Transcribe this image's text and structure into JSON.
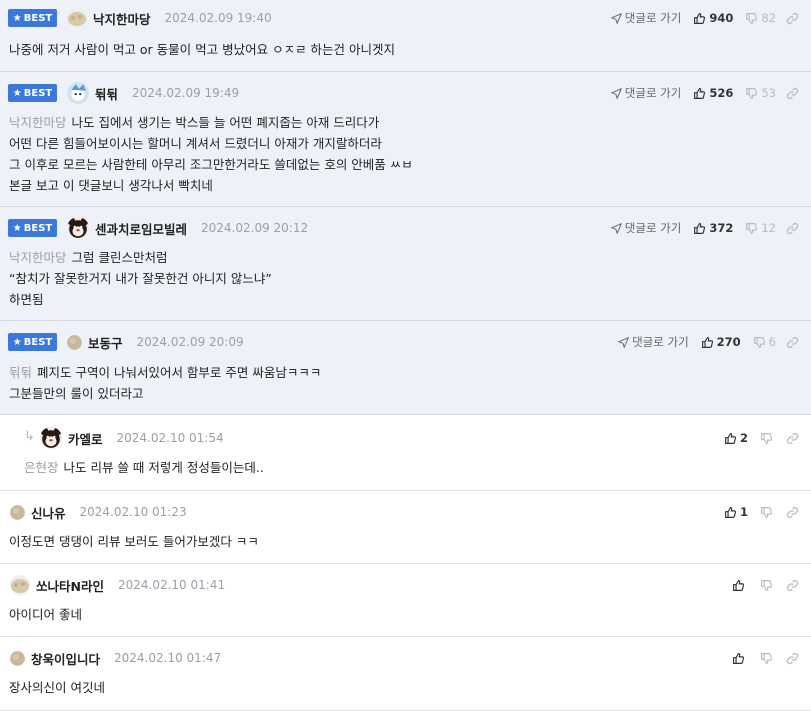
{
  "labels": {
    "best": "BEST",
    "reply_link": "댓글로 가기"
  },
  "colors": {
    "best_badge": "#3a78dc",
    "best_bg": "#eef2f8",
    "muted": "#9aa0a8"
  },
  "comments": [
    {
      "best": true,
      "nick": "낙지한마당",
      "date": "2024.02.09 19:40",
      "mention": "",
      "lines": [
        "나중에 저거 사람이 먹고 or 동물이 먹고 병났어요 ㅇㅈㄹ 하는건 아니겟지"
      ],
      "likes": "940",
      "dislikes": "82",
      "avatar_icon": "mushroom-avatar-icon"
    },
    {
      "best": true,
      "nick": "뒦뒦",
      "date": "2024.02.09 19:49",
      "mention": "낙지한마당",
      "lines": [
        "나도 집에서 생기는 박스들 늘 어떤 폐지줍는 아재 드리다가",
        "어떤 다른 힘들어보이시는 할머니 계셔서 드렸더니 아재가 개지랄하더라",
        "그 이후로 모르는 사람한테 아무리 조그만한거라도 쓸데없는 호의 안베품 ㅆㅂ",
        "본글 보고 이 댓글보니 생각나서 빡치네"
      ],
      "likes": "526",
      "dislikes": "53",
      "avatar_icon": "snow-character-avatar-icon"
    },
    {
      "best": true,
      "nick": "센과치로임모빌레",
      "date": "2024.02.09 20:12",
      "mention": "낙지한마당",
      "lines": [
        "그럼 클린스만처럼",
        "“참치가 잘못한거지 내가 잘못한건 아니지 않느냐”",
        "하면됨"
      ],
      "likes": "372",
      "dislikes": "12",
      "avatar_icon": "bear-avatar-icon"
    },
    {
      "best": true,
      "nick": "보동구",
      "date": "2024.02.09 20:09",
      "mention": "뒦뒦",
      "lines": [
        "폐지도 구역이 나눠서있어서 함부로 주면 싸움남ㅋㅋㅋ",
        "그분들만의 룰이 있더라고"
      ],
      "likes": "270",
      "dislikes": "6",
      "avatar_icon": "circle-avatar-icon"
    },
    {
      "best": false,
      "reply": true,
      "nick": "카엘로",
      "date": "2024.02.10 01:54",
      "mention": "은현장",
      "lines": [
        "나도 리뷰 쓸 때 저렇게 정성들이는데.."
      ],
      "likes": "2",
      "dislikes": "",
      "avatar_icon": "bear-avatar-icon"
    },
    {
      "best": false,
      "nick": "신나유",
      "date": "2024.02.10 01:23",
      "mention": "",
      "lines": [
        "이정도면 댕댕이 리뷰 보러도 들어가보겠다 ㅋㅋ"
      ],
      "likes": "1",
      "dislikes": "",
      "avatar_icon": "circle-avatar-icon"
    },
    {
      "best": false,
      "nick": "쏘나타N라인",
      "date": "2024.02.10 01:41",
      "mention": "",
      "lines": [
        "아이디어 좋네"
      ],
      "likes": "",
      "dislikes": "",
      "avatar_icon": "mushroom-avatar-icon"
    },
    {
      "best": false,
      "nick": "창욱이입니다",
      "date": "2024.02.10 01:47",
      "mention": "",
      "lines": [
        "장사의신이 여깃네"
      ],
      "likes": "",
      "dislikes": "",
      "avatar_icon": "circle-avatar-icon"
    }
  ]
}
